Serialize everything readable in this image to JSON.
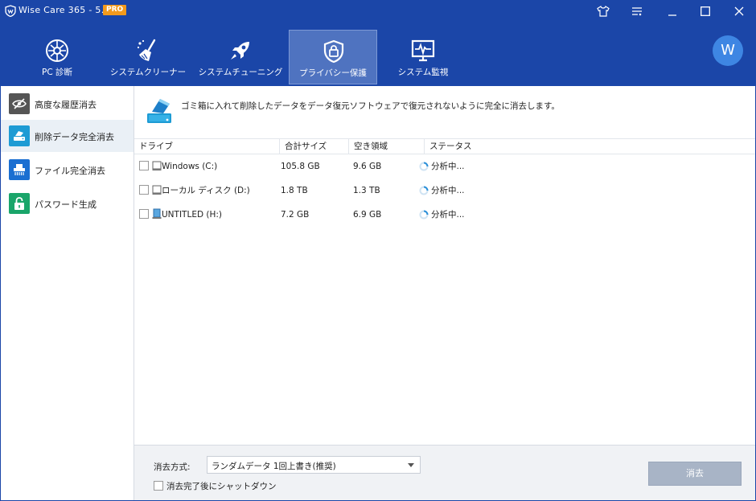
{
  "window": {
    "title": "Wise Care 365 - 5.1.9",
    "badge": "PRO"
  },
  "toolbar": {
    "tabs": [
      {
        "label": "PC 診断",
        "icon": "pc-check-icon"
      },
      {
        "label": "システムクリーナー",
        "icon": "broom-icon"
      },
      {
        "label": "システムチューニング",
        "icon": "rocket-icon"
      },
      {
        "label": "プライバシー保護",
        "icon": "shield-lock-icon"
      },
      {
        "label": "システム監視",
        "icon": "monitor-pulse-icon"
      }
    ],
    "active_tab": 3,
    "avatar_letter": "W"
  },
  "sidebar": {
    "items": [
      {
        "label": "高度な履歴消去",
        "icon": "eye-slash-icon",
        "color": "#555555"
      },
      {
        "label": "削除データ完全消去",
        "icon": "disk-erase-icon",
        "color": "#1d9bd4"
      },
      {
        "label": "ファイル完全消去",
        "icon": "shredder-icon",
        "color": "#1b6fd1"
      },
      {
        "label": "パスワード生成",
        "icon": "padlock-icon",
        "color": "#1aa56a"
      }
    ],
    "active_item": 1
  },
  "main": {
    "description": "ゴミ箱に入れて削除したデータをデータ復元ソフトウェアで復元されないように完全に消去します。",
    "columns": [
      "ドライブ",
      "合計サイズ",
      "空き領域",
      "ステータス"
    ],
    "rows": [
      {
        "drive": "Windows (C:)",
        "total": "105.8 GB",
        "free": "9.6 GB",
        "status": "分析中..."
      },
      {
        "drive": "ローカル ディスク (D:)",
        "total": "1.8 TB",
        "free": "1.3 TB",
        "status": "分析中..."
      },
      {
        "drive": "UNTITLED (H:)",
        "total": "7.2 GB",
        "free": "6.9 GB",
        "status": "分析中..."
      }
    ]
  },
  "bottom": {
    "method_label": "消去方式:",
    "method_value": "ランダムデータ 1回上書き(推奨)",
    "shutdown_label": "消去完了後にシャットダウン",
    "erase_button": "消去"
  },
  "colors": {
    "brand": "#1b46a8",
    "active_tab": "#4f73c0",
    "pro_badge": "#f39a1d",
    "erase_button": "#a8b4c6"
  }
}
